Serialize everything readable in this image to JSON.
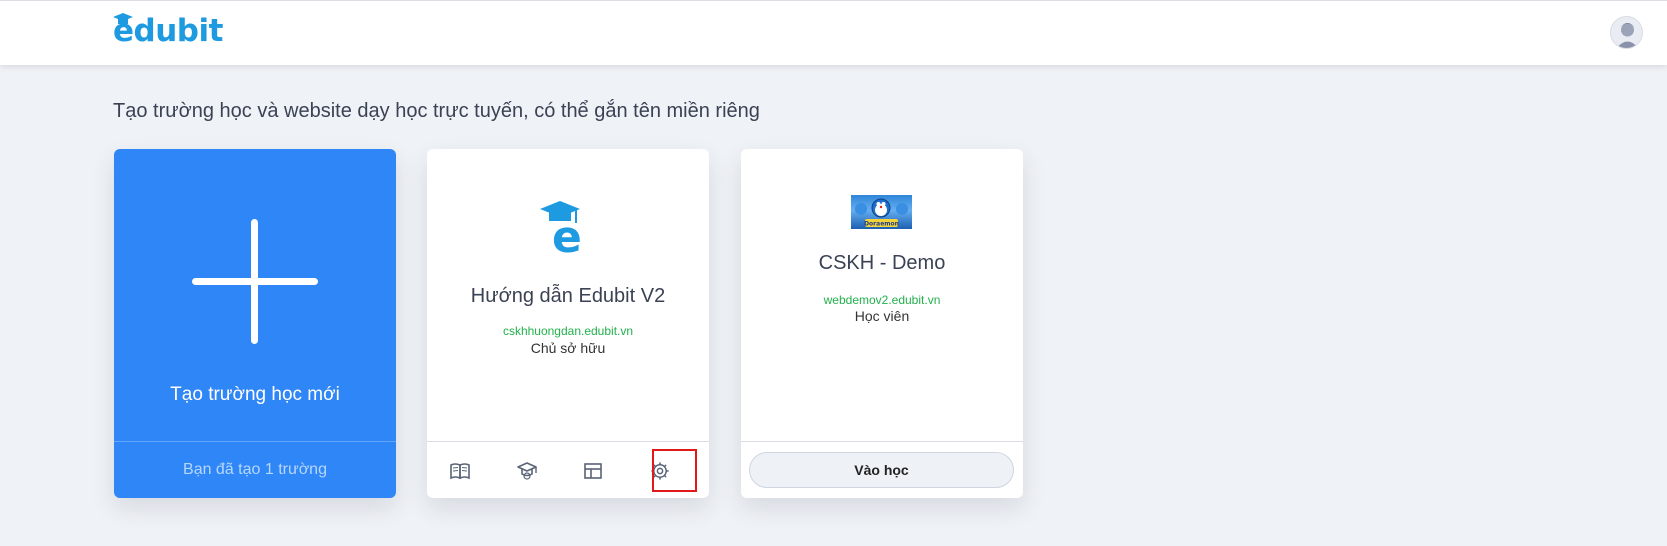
{
  "header": {
    "logo_text": "edubit",
    "brand_color": "#1e9be0",
    "avatar_icon": "user-avatar-icon"
  },
  "page": {
    "subtitle": "Tạo trường học và website dạy học trực tuyến, có thể gắn tên miền riêng"
  },
  "create_card": {
    "icon": "plus-icon",
    "label": "Tạo trường học mới",
    "count_text": "Bạn đã tạo 1 trường",
    "color": "#2f86f6"
  },
  "schools": [
    {
      "name": "Hướng dẫn Edubit V2",
      "domain": "cskhhuongdan.edubit.vn",
      "role": "Chủ sở hữu",
      "logo": "edubit-e-logo",
      "actions": [
        "course-book-icon",
        "graduation-cap-icon",
        "layout-icon",
        "settings-gear-icon"
      ]
    },
    {
      "name": "CSKH - Demo",
      "domain": "webdemov2.edubit.vn",
      "role": "Học viên",
      "logo": "doraemon-thumbnail",
      "thumbnail_text": "Doraemon",
      "button_label": "Vào học"
    }
  ],
  "colors": {
    "domain_green": "#22b14c",
    "highlight_red": "#e11919",
    "page_bg": "#eff2f6"
  }
}
